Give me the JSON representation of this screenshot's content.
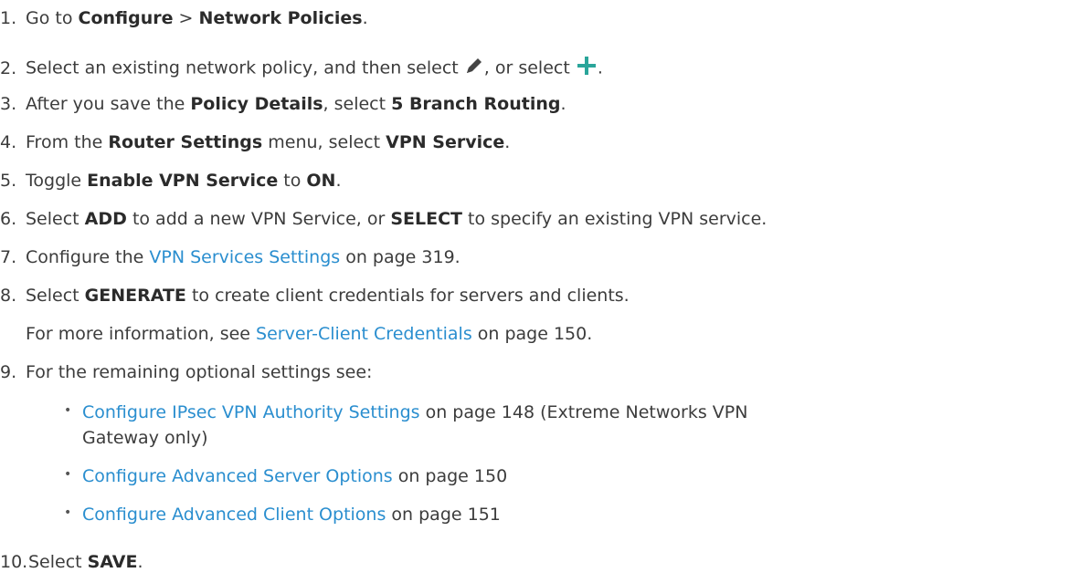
{
  "steps": {
    "s1": {
      "num": "1.",
      "pre": "Go to ",
      "b1": "Configure",
      "mid": " > ",
      "b2": "Network Policies",
      "post": "."
    },
    "s2": {
      "num": "2.",
      "pre": "Select an existing network policy, and then select ",
      "mid": ", or select ",
      "post": "."
    },
    "s3": {
      "num": "3.",
      "pre": "After you save the ",
      "b1": "Policy Details",
      "mid": ", select ",
      "b2": "5 Branch Routing",
      "post": "."
    },
    "s4": {
      "num": "4.",
      "pre": "From the ",
      "b1": "Router Settings",
      "mid": " menu, select ",
      "b2": "VPN Service",
      "post": "."
    },
    "s5": {
      "num": "5.",
      "pre": "Toggle ",
      "b1": "Enable VPN Service",
      "mid": " to ",
      "b2": "ON",
      "post": "."
    },
    "s6": {
      "num": "6.",
      "pre": "Select ",
      "b1": "ADD",
      "mid": " to add a new VPN Service, or ",
      "b2": "SELECT",
      "post": " to specify an existing VPN service."
    },
    "s7": {
      "num": "7.",
      "pre": "Configure the ",
      "link": "VPN Services Settings",
      "post": " on page 319."
    },
    "s8": {
      "num": "8.",
      "pre": "Select ",
      "b1": "GENERATE",
      "post": " to create client credentials for servers and clients."
    },
    "s8_more": {
      "pre": "For more information, see ",
      "link": "Server-Client Credentials",
      "post": " on page 150."
    },
    "s9": {
      "num": "9.",
      "text": "For the remaining optional settings see:"
    },
    "s10": {
      "num": "10.",
      "pre": "Select ",
      "b1": "SAVE",
      "post": "."
    }
  },
  "sub_items": [
    {
      "bullet": "•",
      "link": "Configure IPsec VPN Authority Settings",
      "post": " on page 148 (Extreme Networks VPN",
      "cont": "Gateway only)"
    },
    {
      "bullet": "•",
      "link": "Configure Advanced Server Options",
      "post": " on page 150"
    },
    {
      "bullet": "•",
      "link": "Configure Advanced Client Options",
      "post": " on page 151"
    }
  ],
  "icons": {
    "edit": "pencil-icon",
    "add": "plus-icon",
    "accent": "#2aa59a",
    "icon_gray": "#444444",
    "link_color": "#2a8ecf"
  }
}
